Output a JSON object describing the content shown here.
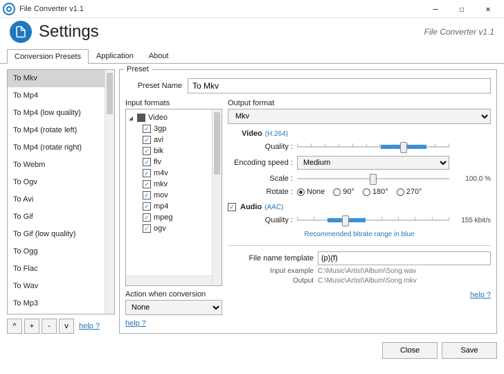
{
  "window": {
    "title": "File Converter v1.1",
    "minimize": "—",
    "maximize": "☐",
    "close": "✕"
  },
  "header": {
    "title": "Settings",
    "subtitle": "File Converter v1.1"
  },
  "tabs": [
    "Conversion Presets",
    "Application",
    "About"
  ],
  "selected_tab": 0,
  "presets": [
    "To Mkv",
    "To Mp4",
    "To Mp4 (low quality)",
    "To Mp4 (rotate left)",
    "To Mp4 (rotate right)",
    "To Webm",
    "To Ogv",
    "To Avi",
    "To Gif",
    "To Gif (low quality)",
    "To Ogg",
    "To Flac",
    "To Wav",
    "To Mp3"
  ],
  "selected_preset": 0,
  "list_buttons": {
    "up": "^",
    "add": "+",
    "remove": "-",
    "down": "v",
    "help": "help ?"
  },
  "preset_panel": {
    "legend": "Preset",
    "name_label": "Preset Name",
    "name_value": "To Mkv",
    "input_formats_label": "Input formats",
    "input_tree": {
      "group": "Video",
      "items": [
        "3gp",
        "avi",
        "bik",
        "flv",
        "m4v",
        "mkv",
        "mov",
        "mp4",
        "mpeg",
        "ogv"
      ]
    },
    "action_label": "Action when conversion",
    "action_value": "None",
    "help": "help ?"
  },
  "output": {
    "legend": "Output format",
    "format": "Mkv",
    "video_label": "Video",
    "video_codec": "(H.264)",
    "quality_label": "Quality :",
    "encoding_label": "Encoding speed :",
    "encoding_value": "Medium",
    "scale_label": "Scale :",
    "scale_value": "100.0 %",
    "rotate_label": "Rotate :",
    "rotate_options": [
      "None",
      "90°",
      "180°",
      "270°"
    ],
    "rotate_selected": 0,
    "audio_label": "Audio",
    "audio_codec": "(AAC)",
    "audio_checked": true,
    "audio_quality_label": "Quality :",
    "audio_bitrate": "155 kbit/s",
    "reco": "Recommended bitrate range in blue",
    "filename_label": "File name template",
    "filename_value": "(p)(f)",
    "input_example_label": "Input example",
    "input_example_value": "C:\\Music\\Artist\\Album\\Song.wav",
    "output_example_label": "Output",
    "output_example_value": "C:\\Music\\Artist\\Album\\Song.mkv",
    "help": "help ?"
  },
  "footer": {
    "close": "Close",
    "save": "Save"
  }
}
